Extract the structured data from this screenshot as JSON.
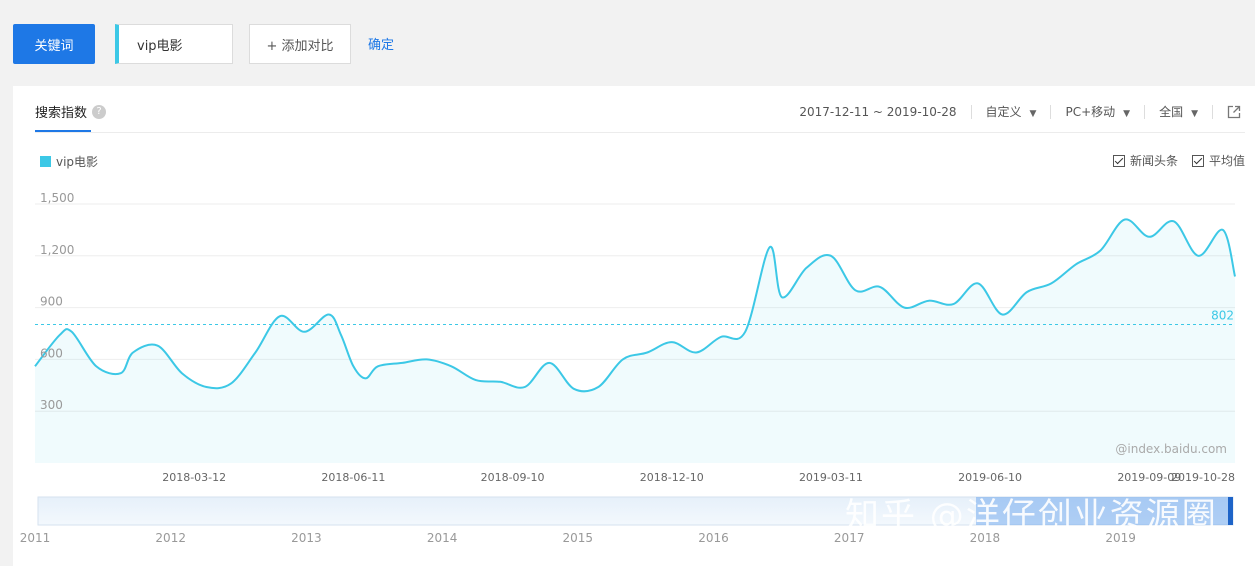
{
  "search": {
    "type_button": "关键词",
    "keyword": "vip电影",
    "add_compare": "+ 添加对比",
    "confirm": "确定"
  },
  "panel": {
    "tab_title": "搜索指数",
    "help_glyph": "?",
    "date_range": "2017-12-11 ~ 2019-10-28",
    "custom_label": "自定义",
    "device_label": "PC+移动",
    "region_label": "全国"
  },
  "options": {
    "news_label": "新闻头条",
    "avg_label": "平均值"
  },
  "watermark": "@index.baidu.com",
  "overlay_watermark": "知乎 @洋仔创业资源圈",
  "navigator": {
    "years": [
      "2011",
      "2012",
      "2013",
      "2014",
      "2015",
      "2016",
      "2017",
      "2018",
      "2019"
    ]
  },
  "colors": {
    "accent": "#1e78e6",
    "series": "#3cc8e6"
  },
  "chart_data": {
    "type": "area",
    "series": [
      {
        "name": "vip电影",
        "x": [
          "2017-12-11",
          "2017-12-25",
          "2018-01-01",
          "2018-01-15",
          "2018-01-29",
          "2018-02-05",
          "2018-02-19",
          "2018-03-05",
          "2018-03-19",
          "2018-04-02",
          "2018-04-16",
          "2018-04-30",
          "2018-05-14",
          "2018-05-28",
          "2018-06-04",
          "2018-06-11",
          "2018-06-18",
          "2018-06-25",
          "2018-07-09",
          "2018-07-23",
          "2018-08-06",
          "2018-08-20",
          "2018-09-03",
          "2018-09-17",
          "2018-10-01",
          "2018-10-15",
          "2018-10-29",
          "2018-11-12",
          "2018-11-26",
          "2018-12-10",
          "2018-12-24",
          "2019-01-07",
          "2019-01-21",
          "2019-02-04",
          "2019-02-11",
          "2019-02-25",
          "2019-03-11",
          "2019-03-25",
          "2019-04-08",
          "2019-04-22",
          "2019-05-06",
          "2019-05-20",
          "2019-06-03",
          "2019-06-17",
          "2019-07-01",
          "2019-07-15",
          "2019-07-29",
          "2019-08-12",
          "2019-08-26",
          "2019-09-09",
          "2019-09-23",
          "2019-10-07",
          "2019-10-21",
          "2019-10-28"
        ],
        "values": [
          560,
          740,
          760,
          560,
          520,
          640,
          680,
          520,
          440,
          460,
          640,
          850,
          760,
          860,
          740,
          560,
          490,
          560,
          580,
          600,
          560,
          480,
          470,
          440,
          580,
          430,
          440,
          600,
          640,
          700,
          640,
          730,
          760,
          1250,
          960,
          1130,
          1200,
          1000,
          1020,
          900,
          940,
          920,
          1040,
          860,
          990,
          1040,
          1150,
          1230,
          1410,
          1310,
          1400,
          1200,
          1350,
          1080
        ]
      }
    ],
    "average": 802,
    "average_label": "802",
    "xticks": [
      "2018-03-12",
      "2018-06-11",
      "2018-09-10",
      "2018-12-10",
      "2019-03-11",
      "2019-06-10",
      "2019-09-09",
      "2019-10-28"
    ],
    "yticks": [
      300,
      600,
      900,
      1200,
      1500
    ],
    "ytick_labels": [
      "300",
      "600",
      "900",
      "1,200",
      "1,500"
    ],
    "ylim": [
      0,
      1500
    ],
    "xlim": [
      "2017-12-11",
      "2019-10-28"
    ],
    "grid": true,
    "legend": "top-left"
  }
}
